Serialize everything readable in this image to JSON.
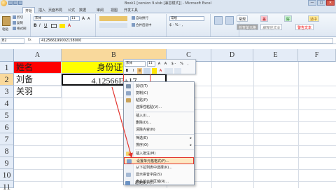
{
  "window": {
    "title": "Book1 [version 9.xlsb [兼容模式]] - Microsoft Excel",
    "buttons": [
      "—",
      "□",
      "✕"
    ]
  },
  "tabs": [
    "开始",
    "插入",
    "页面布局",
    "公式",
    "数据",
    "审阅",
    "视图",
    "开发工具"
  ],
  "active_tab": "开始",
  "ribbon": {
    "paste": "粘贴",
    "cut": "剪切",
    "copy": "复制",
    "format_painter": "格式刷",
    "font_name": "宋体",
    "font_size": "11",
    "wrap": "自动换行",
    "merge": "合并后居中",
    "number_format": "常规",
    "style_normal": "常规",
    "style_bad": "差",
    "style_good": "好",
    "style_neutral": "适中",
    "style_check": "检查单元格",
    "style_explain": "解释性文本",
    "style_warning": "警告文本"
  },
  "formula_bar": {
    "name_box": "B2",
    "fx": "fx",
    "content": "412566199002158000"
  },
  "columns": [
    "A",
    "B",
    "C",
    "D",
    "E",
    "F"
  ],
  "rows": [
    "1",
    "2",
    "3",
    "4",
    "5",
    "6",
    "7",
    "8",
    "9",
    "10",
    "11"
  ],
  "cells": {
    "A1": "姓名",
    "B1": "身份证号",
    "A2": "刘备",
    "B2": "4.12566E+17",
    "A3": "关羽"
  },
  "mini_toolbar": {
    "font": "宋体",
    "size": "11",
    "bold": "B",
    "italic": "I",
    "align": "≡",
    "font_color_label": "A",
    "percent": "%",
    "comma": ","
  },
  "context_menu": [
    "剪切(T)",
    "复制(C)",
    "粘贴(P)",
    "选择性粘贴(V)...",
    "插入(I)...",
    "删除(D)...",
    "清除内容(N)",
    "筛选(E)",
    "排序(O)",
    "插入批注(M)",
    "设置单元格格式(F)...",
    "从下拉列表中选择(K)...",
    "显示拼音字段(S)",
    "命名单元格区域(R)...",
    "超链接(H)..."
  ],
  "highlighted_item": "设置单元格格式(F)...",
  "colors": {
    "a1_fill": "#ff0000",
    "b1_fill": "#ffff00",
    "highlight_border": "#e2352f",
    "arrow": "#e2352f"
  }
}
